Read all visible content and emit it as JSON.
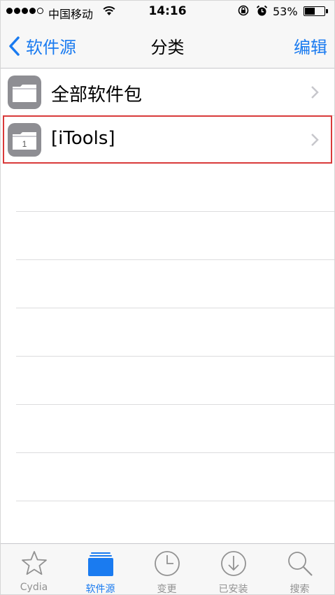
{
  "status_bar": {
    "carrier": "中国移动",
    "time": "14:16",
    "battery_percent": "53%",
    "battery_level": 0.53,
    "signal_bars_filled": 4,
    "signal_bars_total": 5
  },
  "nav": {
    "back_label": "软件源",
    "title": "分类",
    "edit_label": "编辑"
  },
  "rows": [
    {
      "label": "全部软件包",
      "icon": "folder-icon"
    },
    {
      "label": "[iTools]",
      "badge": "1",
      "icon": "folder-icon"
    }
  ],
  "tabs": [
    {
      "label": "Cydia",
      "icon": "star-icon",
      "active": false
    },
    {
      "label": "软件源",
      "icon": "sources-icon",
      "active": true
    },
    {
      "label": "变更",
      "icon": "clock-icon",
      "active": false
    },
    {
      "label": "已安装",
      "icon": "download-icon",
      "active": false
    },
    {
      "label": "搜索",
      "icon": "search-icon",
      "active": false
    }
  ],
  "colors": {
    "accent": "#1a7bf0",
    "highlight_border": "#d93a3a",
    "inactive_tab": "#929292"
  }
}
